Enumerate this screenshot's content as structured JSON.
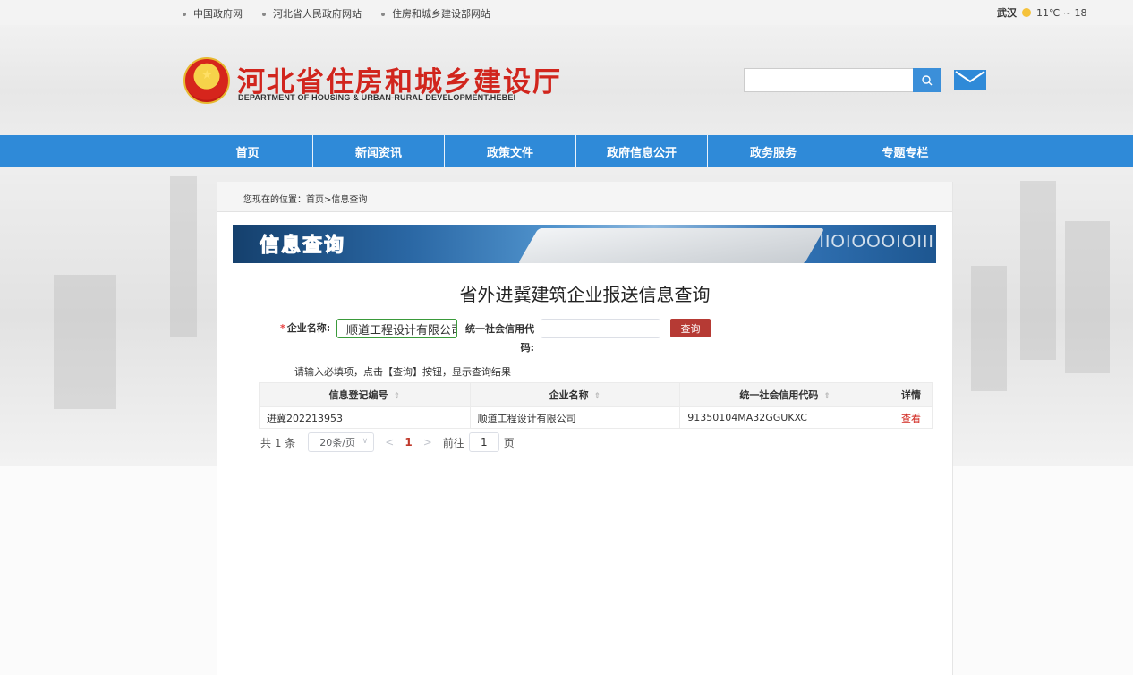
{
  "topbar": {
    "links": [
      "中国政府网",
      "河北省人民政府网站",
      "住房和城乡建设部网站"
    ],
    "weather_city": "武汉",
    "weather_temp": "11℃ ~ 18"
  },
  "header": {
    "title": "河北省住房和城乡建设厅",
    "subtitle": "DEPARTMENT OF HOUSING & URBAN-RURAL DEVELOPMENT.HEBEI",
    "search_placeholder": ""
  },
  "nav": {
    "items": [
      "首页",
      "新闻资讯",
      "政策文件",
      "政府信息公开",
      "政务服务",
      "专题专栏"
    ]
  },
  "breadcrumb": "您现在的位置：首页>信息查询",
  "banner": {
    "title": "信息查询",
    "binary": "IIOIOOOIOIII"
  },
  "page": {
    "title": "省外进冀建筑企业报送信息查询",
    "required_star": "*",
    "company_label": "企业名称:",
    "company_value": "顺道工程设计有限公司",
    "code_label": "统一社会信用代码:",
    "code_value": "",
    "query_button": "查询",
    "hint": "请输入必填项，点击【查询】按钮，显示查询结果"
  },
  "table": {
    "headers": [
      "信息登记编号",
      "企业名称",
      "统一社会信用代码",
      "详情"
    ],
    "rows": [
      {
        "reg_no": "进冀202213953",
        "name": "顺道工程设计有限公司",
        "code": "91350104MA32GGUKXC",
        "action": "查看"
      }
    ]
  },
  "pager": {
    "total": "共 1 条",
    "page_size": "20条/页",
    "current_page": "1",
    "goto_prefix": "前往",
    "goto_value": "1",
    "goto_suffix": "页"
  },
  "colors": {
    "nav": "#2f8ad8",
    "brand_red": "#d1251d",
    "query_button": "#b63a34"
  }
}
